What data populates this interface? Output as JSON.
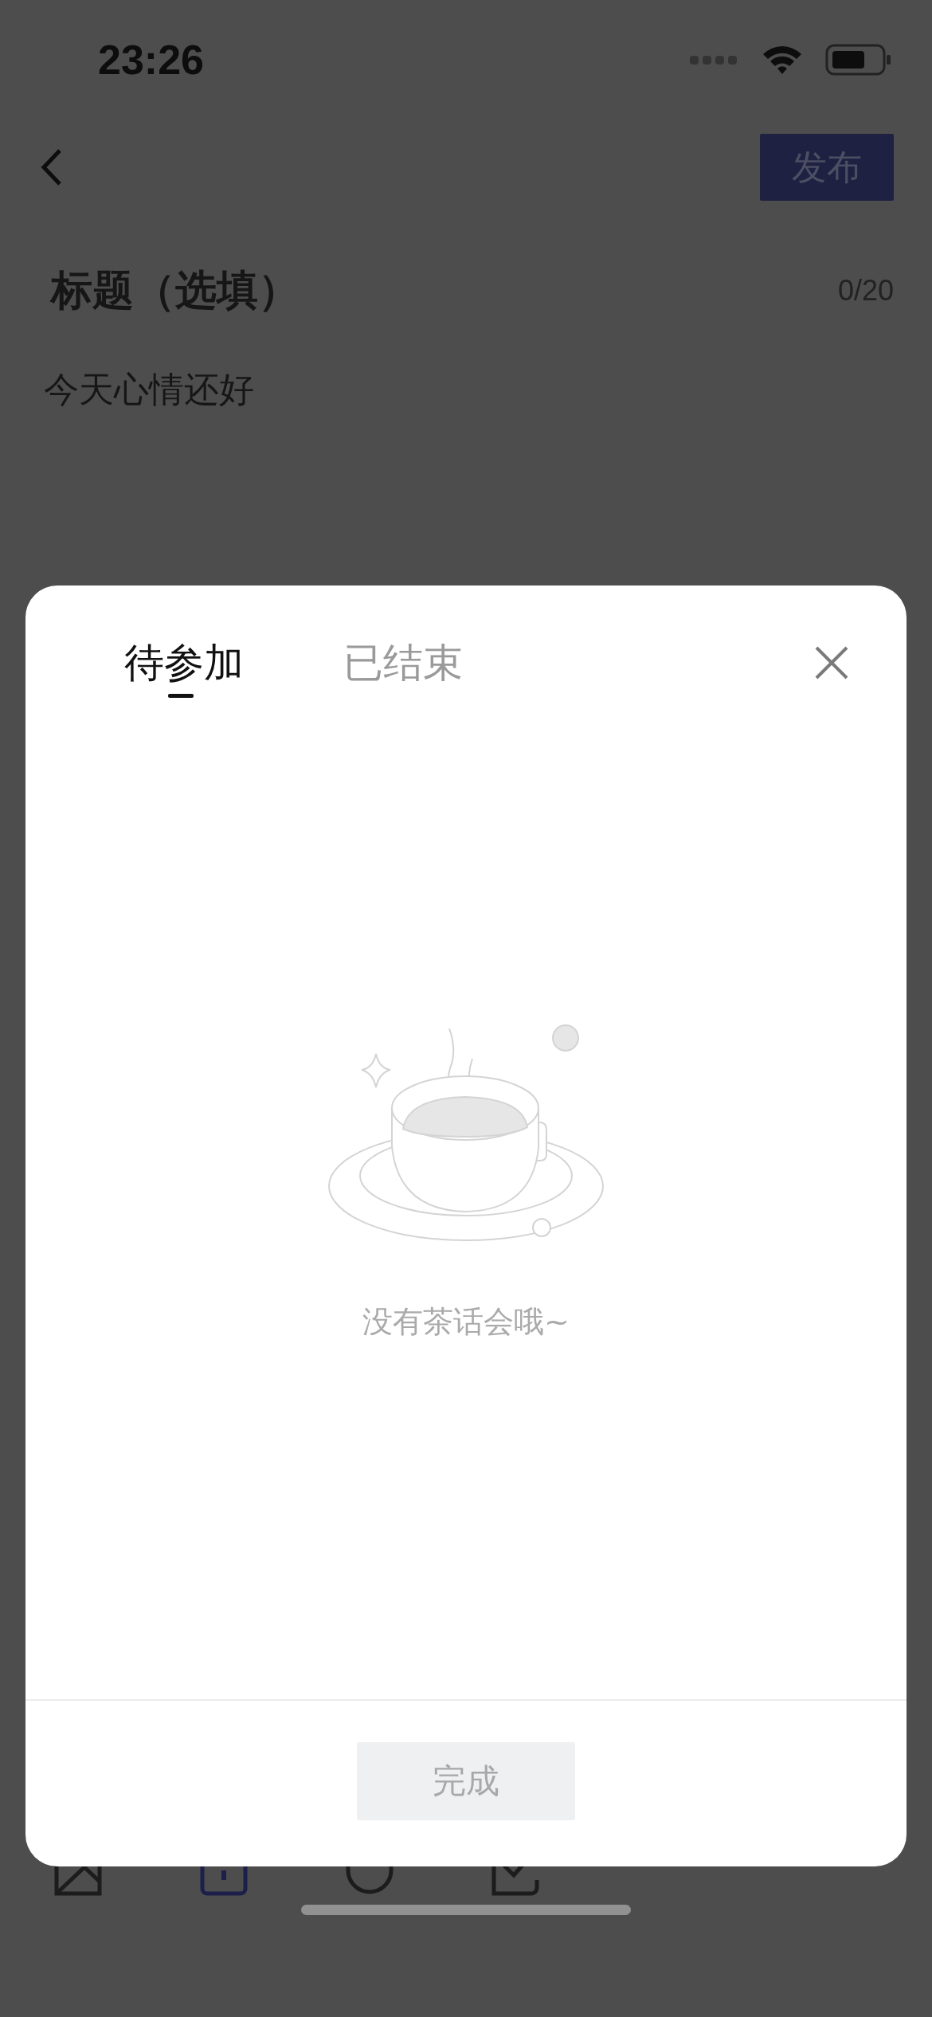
{
  "status_bar": {
    "time": "23:26"
  },
  "header": {
    "publish_button": "发布"
  },
  "editor": {
    "title_placeholder": "标题（选填）",
    "title_counter": "0/20",
    "body": "今天心情还好"
  },
  "sheet": {
    "tabs": [
      {
        "label": "待参加",
        "selected": true
      },
      {
        "label": "已结束",
        "selected": false
      }
    ],
    "empty_text": "没有茶话会哦~",
    "done_button": "完成"
  }
}
